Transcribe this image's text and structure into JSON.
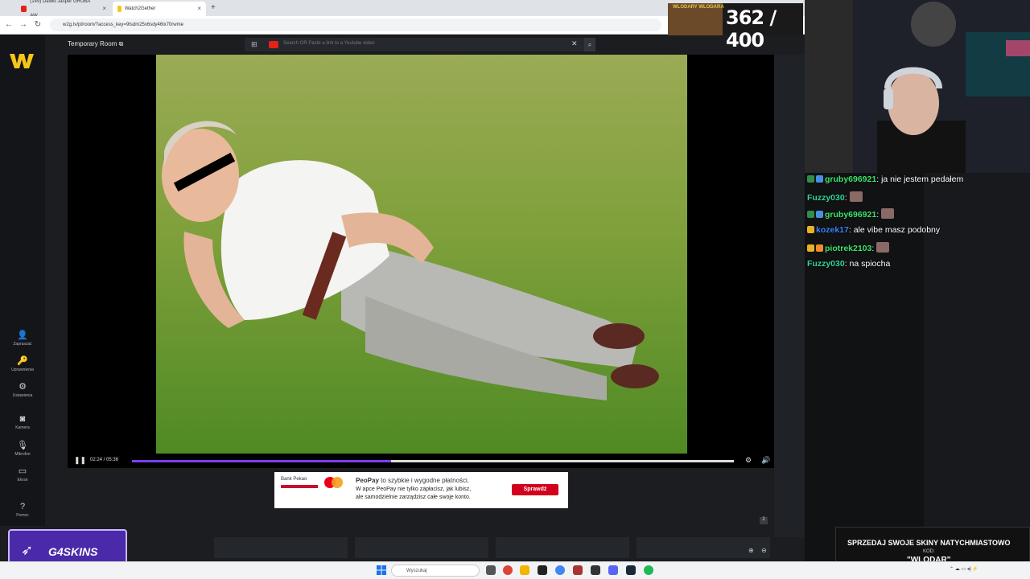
{
  "browser": {
    "tabs": [
      {
        "label": "(149) Dawid Jasper GRUBA AW...",
        "active": false
      },
      {
        "label": "Watch2Gether",
        "active": true
      }
    ],
    "url": "w2g.tv/pl/room/?access_key=9tsdm25x6sdy46lx70rwme"
  },
  "app": {
    "room_title": "Temporary Room",
    "search_placeholder": "Search OR Paste a link to a Youtube video",
    "nav": [
      {
        "label": "Zapraszać",
        "icon": "add-user-icon"
      },
      {
        "label": "Uprawnienia",
        "icon": "key-icon"
      },
      {
        "label": "Ustawienia",
        "icon": "gear-icon"
      },
      {
        "label": "Kamera",
        "icon": "camera-icon"
      },
      {
        "label": "Mikrofon",
        "icon": "microphone-icon"
      },
      {
        "label": "Ekran",
        "icon": "monitor-icon"
      },
      {
        "label": "Pomoc",
        "icon": "help-icon"
      }
    ],
    "player": {
      "time": "02:24 / 05:36",
      "progress": 0.43,
      "buffered": 1.0,
      "user_count": "2"
    }
  },
  "ad": {
    "bank": "Bank Pekao",
    "title_brand": "PeoPay",
    "title_rest": "to szybkie i wygodne płatności.",
    "line2": "W apce PeoPay nie tylko zapłacisz, jak lubisz,",
    "line3": "ale samodzielnie zarządzisz całe swoje konto.",
    "cta": "Sprawdź"
  },
  "stream": {
    "goal": "362 / 400",
    "goal_label": "WLODARY WLODARA",
    "chat": [
      {
        "user": "gruby696921",
        "color": "#3ee36b",
        "text": "ja nie jestem pedałem",
        "badges": [
          "#2f8f4a",
          "#4a90e2"
        ]
      },
      {
        "user": "Fuzzy030",
        "color": "#34d399",
        "text": "",
        "emote": true,
        "badges": []
      },
      {
        "user": "gruby696921",
        "color": "#3ee36b",
        "text": "",
        "emote": true,
        "badges": [
          "#2f8f4a",
          "#4a90e2"
        ]
      },
      {
        "user": "kozek17",
        "color": "#3b82f6",
        "text": "ale vibe masz podobny",
        "badges": [
          "#e6b325"
        ]
      },
      {
        "user": "piotrek2103",
        "color": "#3ee36b",
        "text": "",
        "emote": true,
        "badges": [
          "#e6b325",
          "#f28c28"
        ]
      },
      {
        "user": "Fuzzy030",
        "color": "#34d399",
        "text": "na spiocha",
        "badges": []
      }
    ],
    "sponsor_line1": "SPRZEDAJ SWOJE SKINY NATYCHMIASTOWO",
    "sponsor_code_label": "KOD:",
    "sponsor_code": "\"WLODAR\"",
    "g4_label": "G4SKINS"
  },
  "taskbar": {
    "search": "Wyszukaj"
  }
}
